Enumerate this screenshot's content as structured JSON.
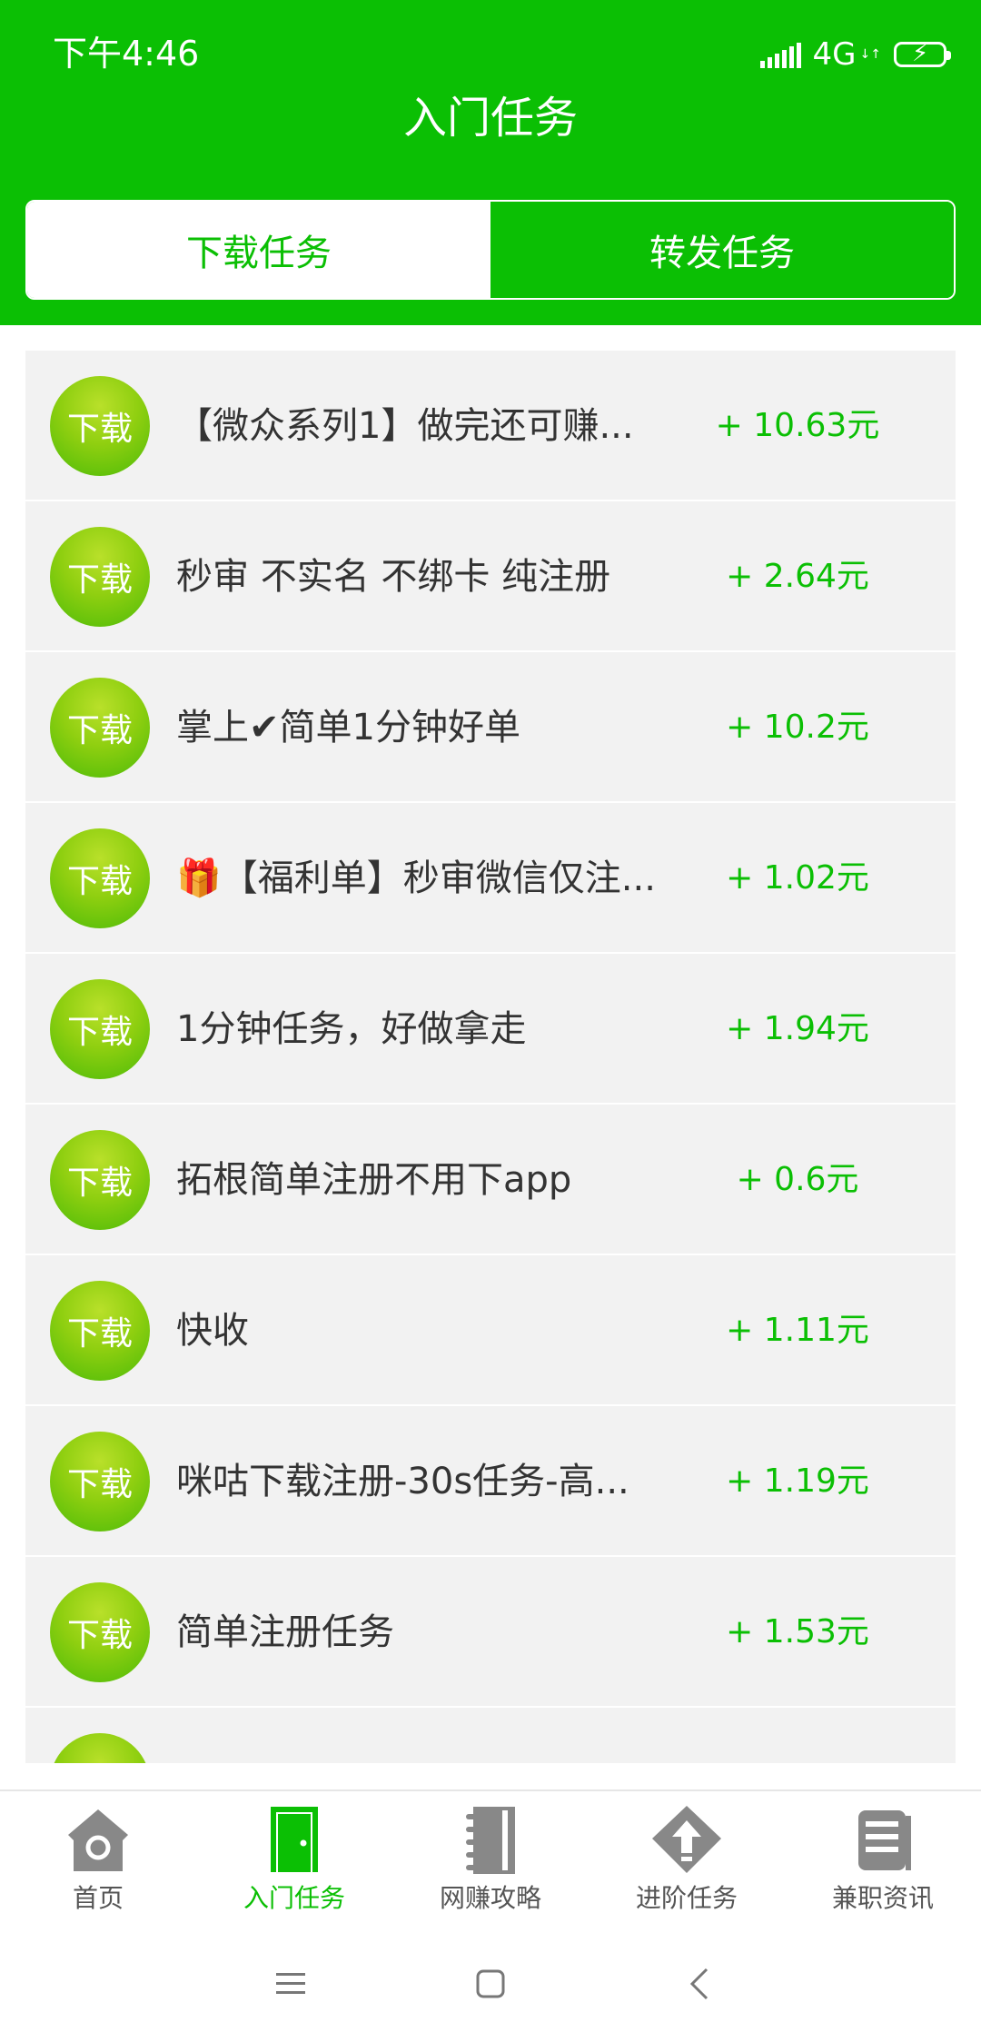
{
  "status_bar": {
    "time": "下午4:46",
    "network": "4G",
    "network_arrows": "↓↑"
  },
  "header": {
    "title": "入门任务"
  },
  "tabs": [
    {
      "label": "下载任务",
      "active": true
    },
    {
      "label": "转发任务",
      "active": false
    }
  ],
  "tasks": [
    {
      "badge": "下载",
      "title": "【微众系列1】做完还可赚...",
      "reward": "+ 10.63元"
    },
    {
      "badge": "下载",
      "title": "秒审 不实名 不绑卡 纯注册",
      "reward": "+ 2.64元"
    },
    {
      "badge": "下载",
      "title": "掌上✔简单1分钟好单",
      "reward": "+ 10.2元"
    },
    {
      "badge": "下载",
      "title": "🎁【福利单】秒审微信仅注...",
      "reward": "+ 1.02元"
    },
    {
      "badge": "下载",
      "title": "1分钟任务，好做拿走",
      "reward": "+ 1.94元"
    },
    {
      "badge": "下载",
      "title": "拓根简单注册不用下app",
      "reward": "+ 0.6元"
    },
    {
      "badge": "下载",
      "title": "快收",
      "reward": "+ 1.11元"
    },
    {
      "badge": "下载",
      "title": "咪咕下载注册-30s任务-高...",
      "reward": "+ 1.19元"
    },
    {
      "badge": "下载",
      "title": "简单注册任务",
      "reward": "+ 1.53元"
    },
    {
      "badge": "下载",
      "title": "",
      "reward": ""
    }
  ],
  "bottom_nav": [
    {
      "label": "首页",
      "icon": "home-icon",
      "active": false
    },
    {
      "label": "入门任务",
      "icon": "door-icon",
      "active": true
    },
    {
      "label": "网赚攻略",
      "icon": "notebook-icon",
      "active": false
    },
    {
      "label": "进阶任务",
      "icon": "upgrade-icon",
      "active": false
    },
    {
      "label": "兼职资讯",
      "icon": "news-icon",
      "active": false
    }
  ],
  "colors": {
    "accent": "#0bbf04",
    "list_bg": "#f2f2f2",
    "text": "#333333"
  }
}
